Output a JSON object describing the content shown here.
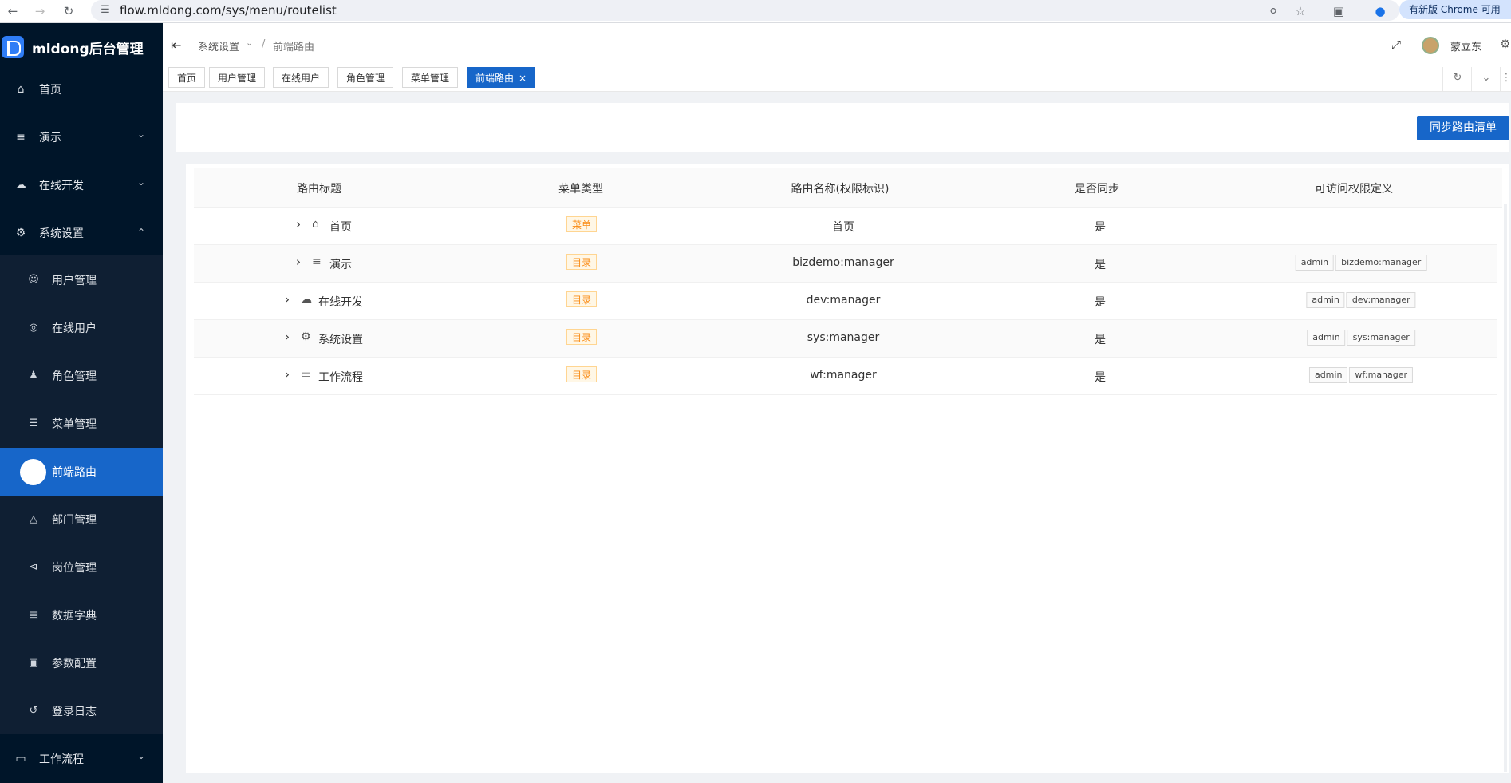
{
  "browser": {
    "url": "flow.mldong.com/sys/menu/routelist",
    "update_text": "有新版 Chrome 可用"
  },
  "sidebar": {
    "logo": "mldong后台管理",
    "items": [
      {
        "label": "首页",
        "icon": "home-icon"
      },
      {
        "label": "演示",
        "icon": "menu-fold-icon"
      },
      {
        "label": "在线开发",
        "icon": "cloud-icon"
      },
      {
        "label": "系统设置",
        "icon": "gear-icon"
      }
    ],
    "sub_items": [
      {
        "label": "用户管理",
        "icon": "user-icon"
      },
      {
        "label": "在线用户",
        "icon": "signal-icon"
      },
      {
        "label": "角色管理",
        "icon": "team-icon"
      },
      {
        "label": "菜单管理",
        "icon": "list-icon"
      },
      {
        "label": "前端路由",
        "icon": "route-icon"
      },
      {
        "label": "部门管理",
        "icon": "apartment-icon"
      },
      {
        "label": "岗位管理",
        "icon": "share-icon"
      },
      {
        "label": "数据字典",
        "icon": "book-icon"
      },
      {
        "label": "参数配置",
        "icon": "file-setting-icon"
      },
      {
        "label": "登录日志",
        "icon": "login-icon"
      }
    ],
    "bottom_item": {
      "label": "工作流程",
      "icon": "laptop-icon"
    }
  },
  "header": {
    "breadcrumb": [
      "系统设置",
      "前端路由"
    ],
    "username": "蒙立东"
  },
  "tabs": [
    "首页",
    "用户管理",
    "在线用户",
    "角色管理",
    "菜单管理",
    "前端路由"
  ],
  "toolbar": {
    "sync_label": "同步路由清单"
  },
  "table": {
    "columns": [
      "路由标题",
      "菜单类型",
      "路由名称(权限标识)",
      "是否同步",
      "可访问权限定义"
    ],
    "rows": [
      {
        "title": "首页",
        "icon": "home-icon",
        "type": "菜单",
        "name": "首页",
        "synced": "是",
        "perms": []
      },
      {
        "title": "演示",
        "icon": "menu-fold-icon",
        "type": "目录",
        "name": "bizdemo:manager",
        "synced": "是",
        "perms": [
          "admin",
          "bizdemo:manager"
        ]
      },
      {
        "title": "在线开发",
        "icon": "cloud-icon",
        "type": "目录",
        "name": "dev:manager",
        "synced": "是",
        "perms": [
          "admin",
          "dev:manager"
        ]
      },
      {
        "title": "系统设置",
        "icon": "gear-icon",
        "type": "目录",
        "name": "sys:manager",
        "synced": "是",
        "perms": [
          "admin",
          "sys:manager"
        ]
      },
      {
        "title": "工作流程",
        "icon": "laptop-icon",
        "type": "目录",
        "name": "wf:manager",
        "synced": "是",
        "perms": [
          "admin",
          "wf:manager"
        ]
      }
    ]
  },
  "colors": {
    "sidebar_bg": "#001529",
    "primary": "#1766c9",
    "tag_orange": "#fa8c16"
  }
}
